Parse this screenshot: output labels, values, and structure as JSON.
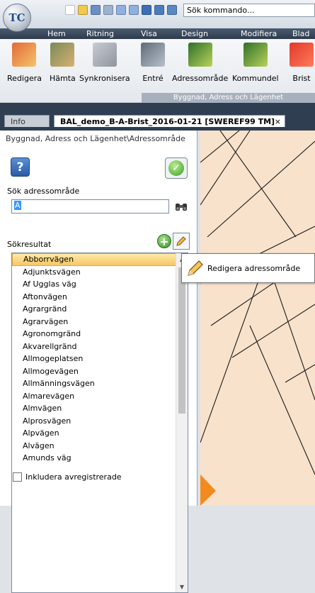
{
  "app": {
    "logo_text": "TC"
  },
  "quick_access": {
    "search_value": "Sök kommando..."
  },
  "ribbon_tabs": [
    "Hem",
    "Ritning",
    "Visa",
    "Design",
    "Modifiera",
    "Blad"
  ],
  "ribbon": {
    "buttons": [
      "Redigera",
      "Hämta",
      "Synkronisera",
      "Entré",
      "Adressområde",
      "Kommundel",
      "Brist"
    ],
    "group_label": "Byggnad, Adress och Lägenhet"
  },
  "document_tabs": {
    "info": "Info",
    "document": "BAL_demo_B-A-Brist_2016-01-21 [SWEREF99 TM]",
    "close": "×"
  },
  "panel": {
    "breadcrumb": "Byggnad, Adress och Lägenhet\\Adressområde",
    "help_label": "?",
    "ok_label": "✓",
    "search_label": "Sök adressområde",
    "search_value": "A",
    "results_label": "Sökresultat",
    "add_label": "+",
    "results": [
      "Abborrvägen",
      "Adjunktsvägen",
      "Af Ugglas väg",
      "Aftonvägen",
      "Agrargränd",
      "Agrarvägen",
      "Agronomgränd",
      "Akvarellgränd",
      "Allmogeplatsen",
      "Allmogevägen",
      "Allmänningsvägen",
      "Almarevägen",
      "Almvägen",
      "Alprosvägen",
      "Alpvägen",
      "Alvägen",
      "Amunds väg"
    ],
    "selected_index": 0,
    "include_deregistered_label": "Inkludera avregistrerade",
    "include_deregistered_checked": false
  },
  "tooltip": {
    "text": "Redigera adressområde"
  },
  "colors": {
    "map_background": "#f8e2cb",
    "map_lines": "#1a1a1a",
    "map_marker": "#f28a1f",
    "selection_highlight": "#f7c765",
    "tab_strip": "#2f3e50"
  }
}
